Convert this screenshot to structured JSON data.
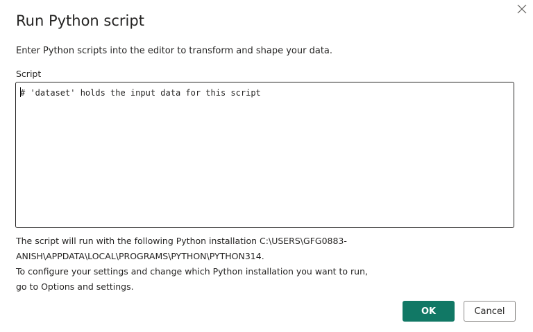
{
  "dialog": {
    "title": "Run Python script",
    "description": "Enter Python scripts into the editor to transform and shape your data.",
    "close_icon": "close-icon",
    "script_label": "Script",
    "script_value": "# 'dataset' holds the input data for this script",
    "info_line_1": "The script will run with the following Python installation C:\\USERS\\GFG0883-",
    "info_line_2": "ANISH\\APPDATA\\LOCAL\\PROGRAMS\\PYTHON\\PYTHON314.",
    "info_line_3": "To configure your settings and change which Python installation you want to run, go to Options and settings.",
    "ok_label": "OK",
    "cancel_label": "Cancel"
  },
  "colors": {
    "primary_button": "#117865",
    "text": "#252423",
    "border": "#252423"
  }
}
